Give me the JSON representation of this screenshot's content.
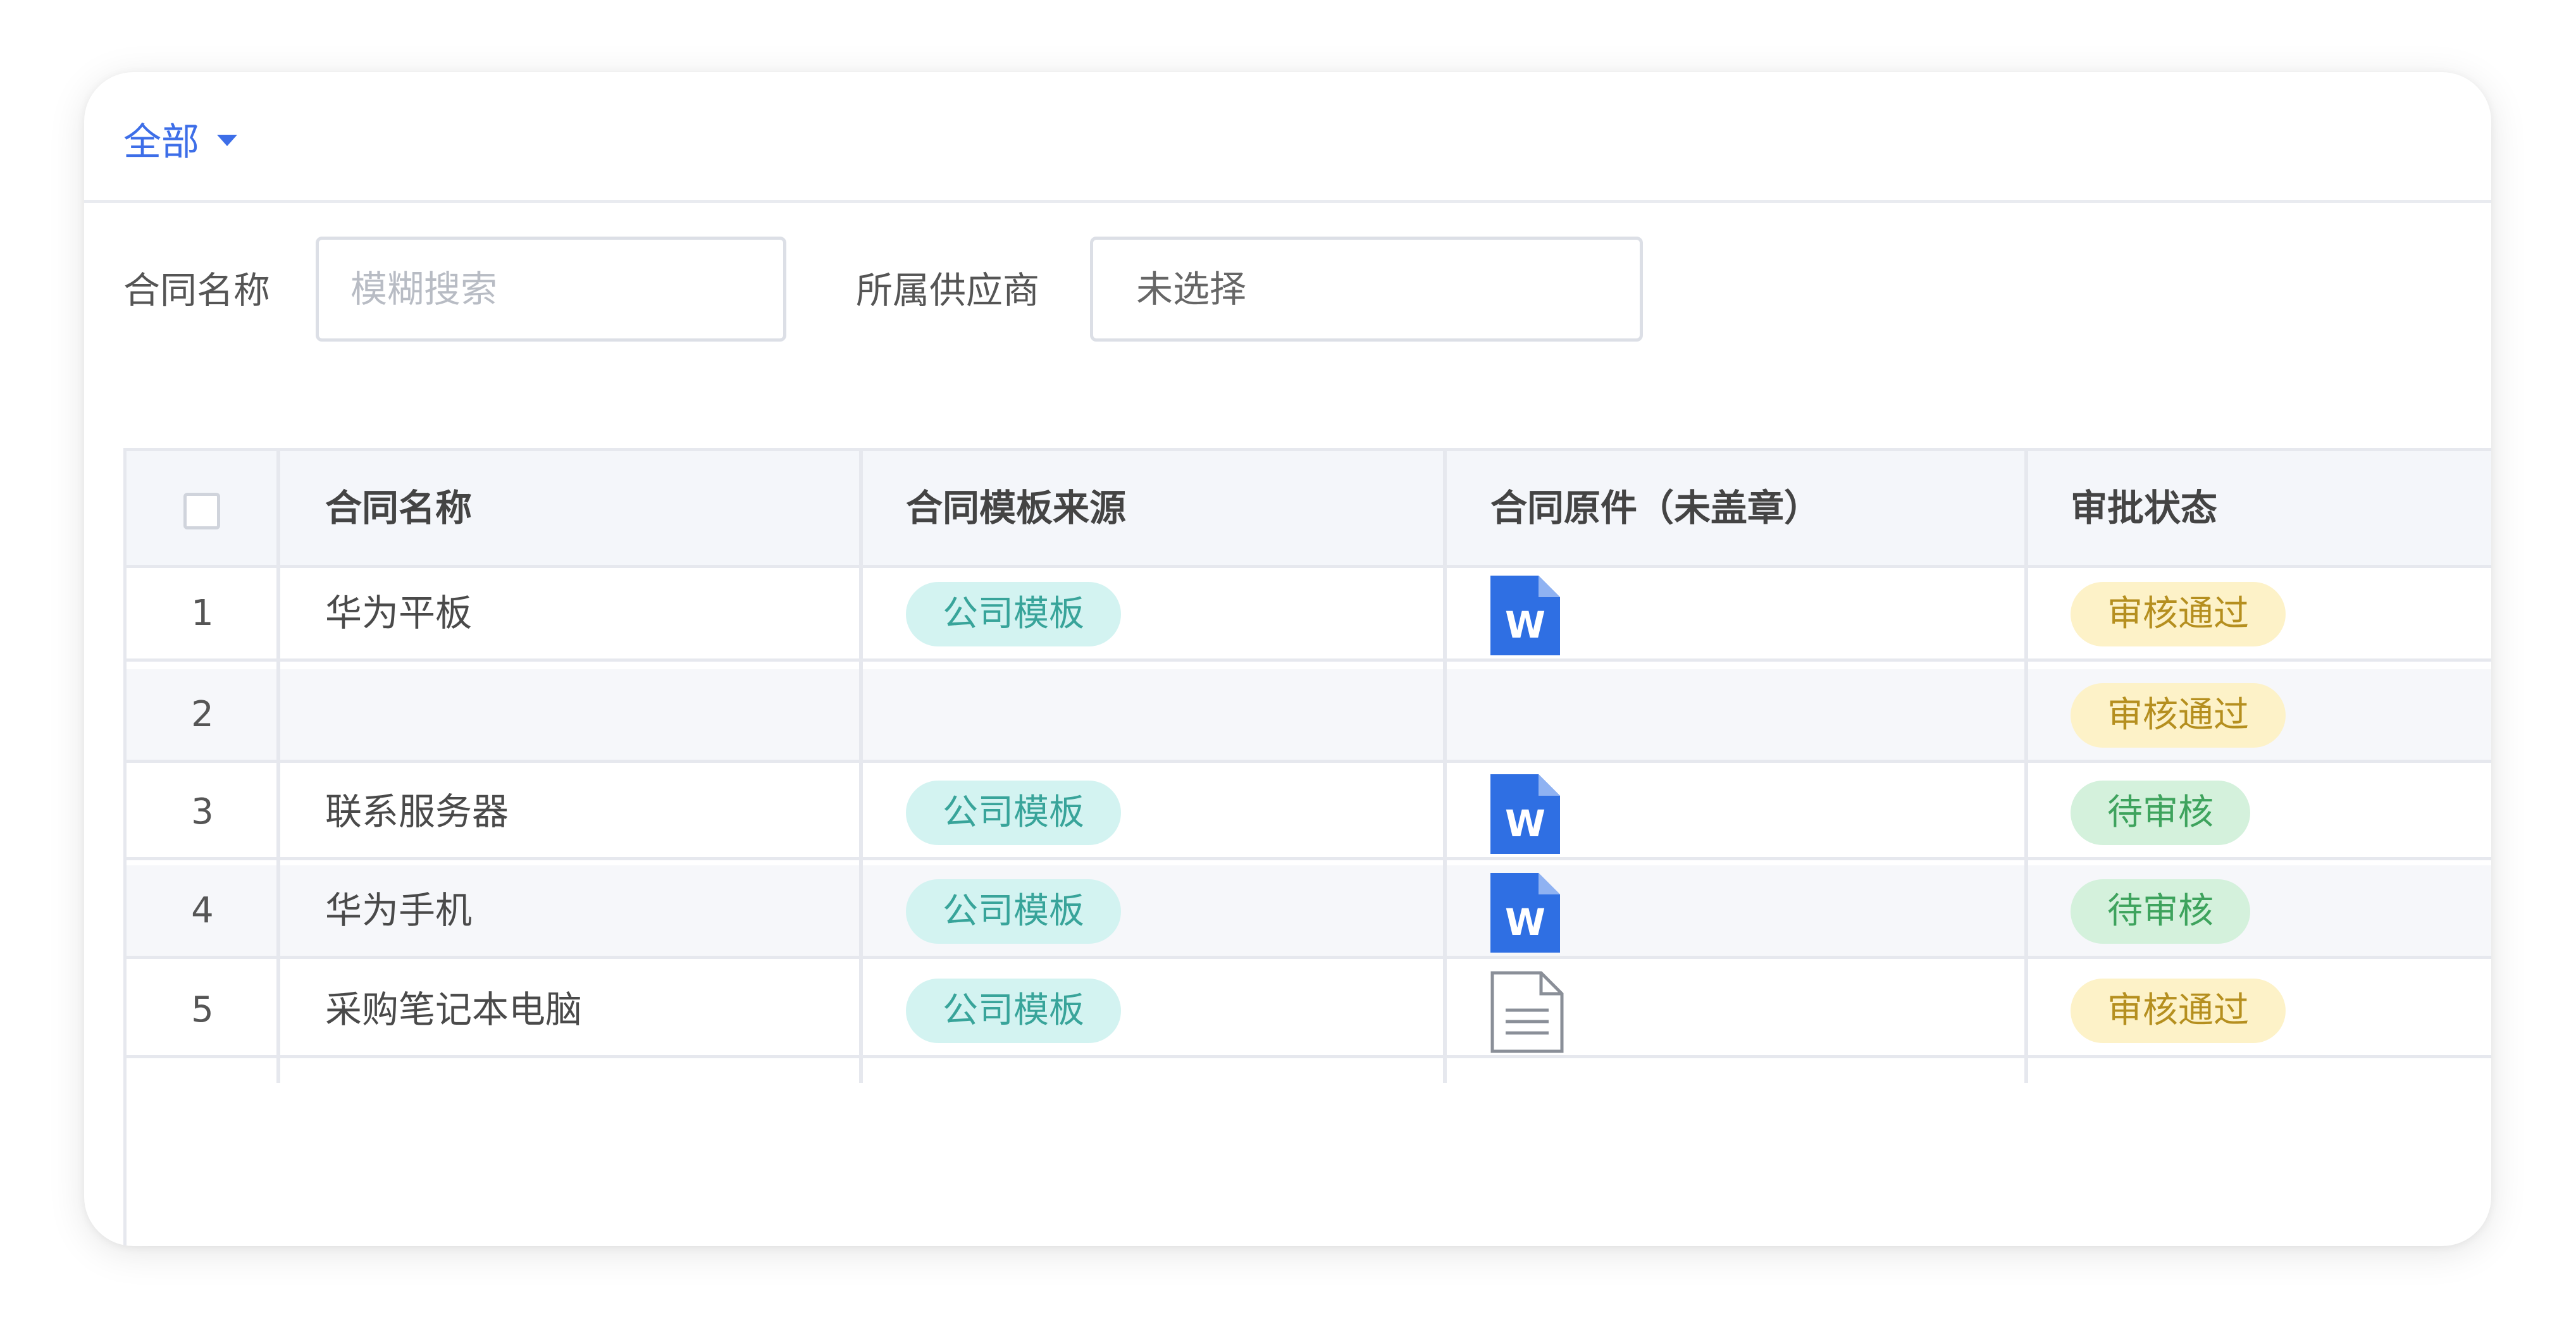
{
  "filter": {
    "label": "全部"
  },
  "search": {
    "contract_name_label": "合同名称",
    "contract_name_placeholder": "模糊搜索",
    "supplier_label": "所属供应商",
    "supplier_value": "未选择"
  },
  "table": {
    "headers": {
      "name": "合同名称",
      "template_source": "合同模板来源",
      "original": "合同原件（未盖章）",
      "approval": "审批状态"
    },
    "rows": [
      {
        "index": "1",
        "name": "华为平板",
        "template": "公司模板",
        "file": "word-icon",
        "status": "审核通过",
        "status_type": "approved"
      },
      {
        "index": "2",
        "name": "",
        "template": "",
        "file": "",
        "status": "审核通过",
        "status_type": "approved"
      },
      {
        "index": "3",
        "name": "联系服务器",
        "template": "公司模板",
        "file": "word-icon",
        "status": "待审核",
        "status_type": "pending"
      },
      {
        "index": "4",
        "name": "华为手机",
        "template": "公司模板",
        "file": "word-icon",
        "status": "待审核",
        "status_type": "pending"
      },
      {
        "index": "5",
        "name": "采购笔记本电脑",
        "template": "公司模板",
        "file": "document-icon",
        "status": "审核通过",
        "status_type": "approved"
      }
    ]
  },
  "colors": {
    "accent": "#3d6ee8",
    "tag_bg": "#d3f3f1",
    "tag_text": "#38a49a",
    "approved_bg": "#fdf2c8",
    "approved_text": "#b58f1f",
    "pending_bg": "#d4f1dc",
    "pending_text": "#3ea35d"
  }
}
